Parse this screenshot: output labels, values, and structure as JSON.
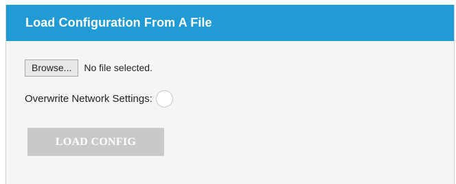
{
  "panel": {
    "title": "Load Configuration From A File"
  },
  "file_input": {
    "browse_label": "Browse...",
    "status_text": "No file selected."
  },
  "overwrite": {
    "label": "Overwrite Network Settings:",
    "checked": false
  },
  "actions": {
    "load_label": "LOAD CONFIG",
    "load_enabled": false
  },
  "colors": {
    "header_background": "#219bd6",
    "panel_background": "#f5f5f5",
    "disabled_button": "#c9c9c9"
  }
}
